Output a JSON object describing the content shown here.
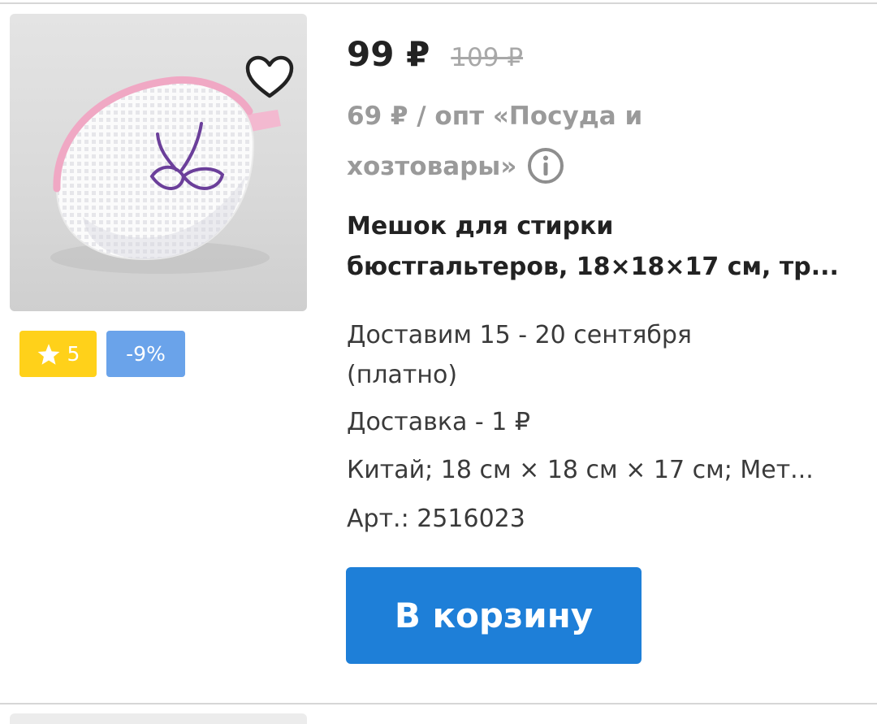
{
  "product": {
    "image_alt": "Мешок для стирки бюстгальтеров",
    "price": "99 ₽",
    "old_price": "109 ₽",
    "wholesale_line1": "69 ₽ / опт «Посуда и",
    "wholesale_line2": "хозтовары»",
    "title_line1": "Мешок для стирки",
    "title_line2": "бюстгальтеров, 18×18×17 см, тр...",
    "delivery_dates_line1": "Доставим 15 - 20 сентября",
    "delivery_dates_line2": "(платно)",
    "delivery_cost": "Доставка - 1 ₽",
    "specs": "Китай; 18 см × 18 см × 17 см; Мет...",
    "sku": "Арт.: 2516023"
  },
  "badges": {
    "rating": "5",
    "discount": "-9%"
  },
  "actions": {
    "add_to_cart": "В корзину"
  },
  "icons": {
    "favorite": "heart-outline-icon",
    "rating": "star-icon",
    "info": "info-circle-icon"
  },
  "colors": {
    "rating_badge": "#ffd11a",
    "discount_badge": "#6aa3ea",
    "cart_button": "#1e7fd8",
    "muted_text": "#9a9a9a"
  }
}
